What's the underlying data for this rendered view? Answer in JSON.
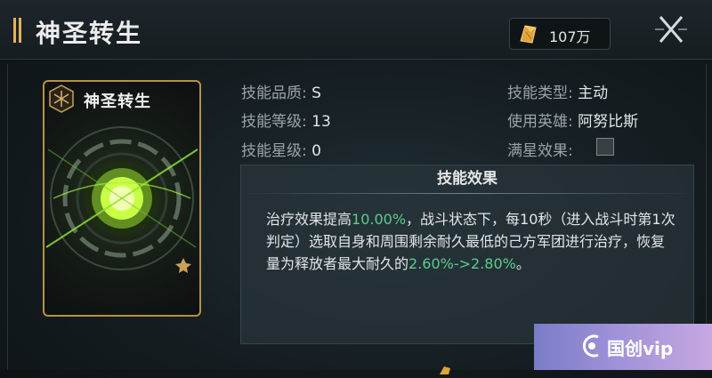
{
  "header": {
    "title": "神圣转生",
    "currency_amount": "107万",
    "currency_icon": "gold-crystal-icon",
    "close_icon": "close-icon"
  },
  "card": {
    "title": "神圣转生",
    "emblem_icon": "rune-emblem-icon",
    "badge_icon": "rank-badge-icon"
  },
  "attributes": {
    "quality_label": "技能品质:",
    "quality_value": "S",
    "level_label": "技能等级:",
    "level_value": "13",
    "star_label": "技能星级:",
    "star_value": "0",
    "type_label": "技能类型:",
    "type_value": "主动",
    "hero_label": "使用英雄:",
    "hero_value": "阿努比斯",
    "max_star_label": "满星效果:",
    "max_star_checked": false
  },
  "effect": {
    "title": "技能效果",
    "seg1": "治疗效果提高",
    "seg2": "10.00%",
    "seg3": "，战斗状态下，每10秒（进入战斗时第1次判定）选取自身和周围剩余耐久最低的己方军团进行治疗，恢复量为释放者最大耐久的",
    "seg4": "2.60%->2.80%",
    "seg5": "。"
  },
  "watermark": {
    "text": "国创vip"
  },
  "colors": {
    "accent_gold": "#e2b35a",
    "highlight_green": "#5dcc8c",
    "card_border": "#b8913f"
  }
}
